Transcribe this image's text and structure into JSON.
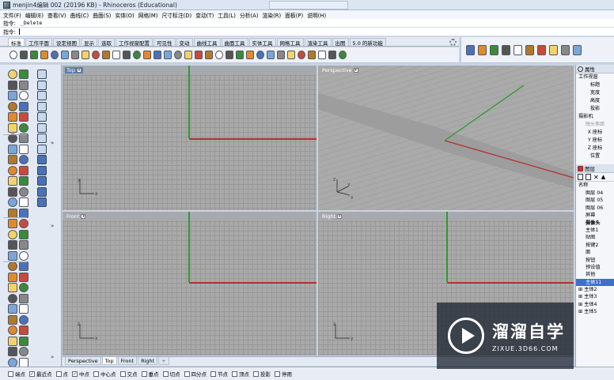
{
  "window": {
    "title": "menjin4编辑 002 (20196 KB) - Rhinoceros (Educational)"
  },
  "menu": [
    "文件(F)",
    "编辑(E)",
    "查看(V)",
    "曲线(C)",
    "曲面(S)",
    "实体(O)",
    "网格(M)",
    "尺寸标注(D)",
    "变动(T)",
    "工具(L)",
    "分析(A)",
    "渲染(R)",
    "面板(P)",
    "说明(H)"
  ],
  "command": {
    "line1_label": "指令:",
    "line1_value": "_Delete",
    "line2_label": "指令:"
  },
  "toolbar_tabs": [
    "标准",
    "工作平面",
    "设定视图",
    "显示",
    "选取",
    "工作视窗配置",
    "可见性",
    "变动",
    "曲线工具",
    "曲面工具",
    "实体工具",
    "网格工具",
    "渲染工具",
    "出图",
    "5.0 的新功能"
  ],
  "viewports": {
    "top": "Top",
    "perspective": "Perspective",
    "front": "Front",
    "right": "Right",
    "axis_x": "x",
    "axis_y": "y",
    "axis_z": "z"
  },
  "viewport_tabs": [
    "Perspective",
    "Top",
    "Front",
    "Right",
    "+"
  ],
  "properties_panel": {
    "title": "属性",
    "section_viewport": "工作视窗",
    "viewport_fields": [
      "标题",
      "宽度",
      "高度",
      "投影"
    ],
    "section_camera": "摄影机",
    "lens_label": "镜头焦距",
    "camera_fields": [
      "X 座标",
      "Y 座标",
      "Z 座标",
      "位置"
    ]
  },
  "layers_panel": {
    "title": "图层",
    "column_name": "名称",
    "layers": [
      {
        "name": "图层 04",
        "style": "normal"
      },
      {
        "name": "图层 05",
        "style": "normal"
      },
      {
        "name": "图层 06",
        "style": "normal"
      },
      {
        "name": "屏幕",
        "style": "normal"
      },
      {
        "name": "摄像头",
        "style": "bold"
      },
      {
        "name": "主体1",
        "style": "normal"
      },
      {
        "name": "贴图",
        "style": "normal"
      },
      {
        "name": "按键2",
        "style": "normal"
      },
      {
        "name": "面",
        "style": "normal"
      },
      {
        "name": "按钮",
        "style": "normal"
      },
      {
        "name": "预设值",
        "style": "normal"
      },
      {
        "name": "其他",
        "style": "normal"
      },
      {
        "name": "主体11",
        "style": "selected"
      },
      {
        "name": "主体2",
        "style": "tree"
      },
      {
        "name": "主体3",
        "style": "tree"
      },
      {
        "name": "主体4",
        "style": "tree"
      },
      {
        "name": "主体5",
        "style": "tree"
      }
    ]
  },
  "osnaps": [
    {
      "label": "端点",
      "checked": false
    },
    {
      "label": "最近点",
      "checked": true
    },
    {
      "label": "点",
      "checked": false
    },
    {
      "label": "中点",
      "checked": true
    },
    {
      "label": "中心点",
      "checked": false
    },
    {
      "label": "交点",
      "checked": false
    },
    {
      "label": "垂点",
      "checked": false
    },
    {
      "label": "切点",
      "checked": false
    },
    {
      "label": "四分点",
      "checked": false
    },
    {
      "label": "节点",
      "checked": false
    },
    {
      "label": "顶点",
      "checked": false
    },
    {
      "label": "投影",
      "checked": false
    },
    {
      "label": "停用",
      "checked": false
    }
  ],
  "watermark": {
    "title": "溜溜自学",
    "url": "ZIXUE.3D66.COM"
  },
  "icons": {
    "app": "rhino-app-icon",
    "settings": "gear-icon",
    "properties": "properties-icon",
    "layers": "layers-icon"
  }
}
